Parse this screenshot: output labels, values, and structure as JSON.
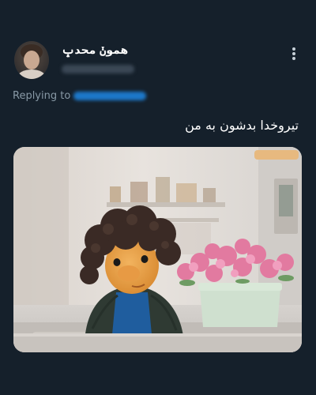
{
  "tweet": {
    "author": {
      "display_name": "هموݩ محدݒ"
    },
    "replying_to_label": "Replying to",
    "text": "تیروخدا بدشون به من",
    "menu_icon": "more-vertical-icon"
  },
  "colors": {
    "background": "#15202b",
    "text_primary": "#ffffff",
    "text_secondary": "#8899a6",
    "link": "#1d9bf0"
  }
}
